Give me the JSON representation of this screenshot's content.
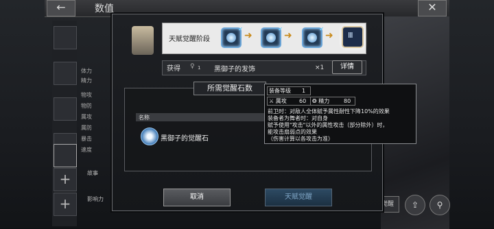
{
  "screen": {
    "title": "数值",
    "back_symbol": "←",
    "close_symbol": "✕",
    "side_labels": [
      "故事",
      "影响力"
    ],
    "stats": [
      {
        "label": "体力"
      },
      {
        "label": "精力"
      },
      {
        "label": "物攻"
      },
      {
        "label": "物防"
      },
      {
        "label": "属攻"
      },
      {
        "label": "属防"
      },
      {
        "label": "暴击"
      },
      {
        "label": "速度"
      }
    ],
    "right_button": "天赋觉醒",
    "icons": [
      "share-icon",
      "search-icon"
    ]
  },
  "modal": {
    "stage_label": "天赋觉醒阶段",
    "obtain_label": "获得",
    "obtain_count": "1",
    "obtain_item": "黑御子的发饰",
    "obtain_qty": "×1",
    "details_button": "详情",
    "required_header": "所需觉醒石数",
    "table_header_name": "名称",
    "stone_name": "黑御子的觉醒石",
    "cancel_button": "取消",
    "awaken_button": "天赋觉醒"
  },
  "tooltip": {
    "level_label": "装备等级",
    "level_value": "1",
    "attr_atk_label": "属攻",
    "attr_atk_value": "60",
    "spirit_label": "精力",
    "spirit_value": "80",
    "lines": [
      "前卫时：对敌人全体赋予属性耐性下降10%的效果",
      "装备者为舞者时：对自身",
      "赋予使用\"攻击\"以外的属性攻击（部分除外）时，",
      "能攻击扇弱点的效果",
      "（伤害计算以各攻击为准）"
    ]
  }
}
